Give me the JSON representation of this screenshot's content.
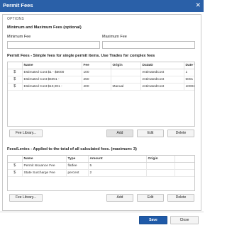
{
  "dialog": {
    "title": "Permit Fees",
    "close_icon": "close-icon"
  },
  "options": {
    "label": "OPTIONS"
  },
  "min_max": {
    "heading": "Minimum and Maximum Fees (optional)",
    "min_label": "Minimum Fee",
    "max_label": "Maximum Fee",
    "min_value": "",
    "max_value": ""
  },
  "permit_fees": {
    "heading": "Permit Fees - Simple fees for single permit items. Use Trades for complex fees",
    "columns": [
      "",
      "Name",
      "Fee",
      "Origin",
      "DataID",
      "Date Va"
    ],
    "rows": [
      {
        "icon": "$",
        "name": "Estimated Cost $1 - $5000",
        "fee": "100",
        "origin": "",
        "dataid": "estimatedCost",
        "dateval": "1"
      },
      {
        "icon": "$",
        "name": "Estimated Cost $5001 -",
        "fee": "250",
        "origin": "",
        "dataid": "estimatedCost",
        "dateval": "5001"
      },
      {
        "icon": "$",
        "name": "Estimated Cost $10,001 -",
        "fee": "400",
        "origin": "Manual",
        "dataid": "estimatedCost",
        "dateval": "10001"
      }
    ],
    "buttons": {
      "library": "Fee Library...",
      "add": "Add",
      "edit": "Edit",
      "delete": "Delete"
    }
  },
  "levies": {
    "heading": "Fees/Levies - Applied to the total of all calculated fees. (maximum: 3)",
    "columns": [
      "",
      "Name",
      "Type",
      "Amount",
      "Origin"
    ],
    "rows": [
      {
        "icon": "$",
        "name": "Permit Issuance Fee",
        "type": "flatfee",
        "amount": "5",
        "origin": ""
      },
      {
        "icon": "$",
        "name": "State Surcharge Fee",
        "type": "percent",
        "amount": "2",
        "origin": ""
      }
    ],
    "buttons": {
      "library": "Fee Library...",
      "add": "Add",
      "edit": "Edit",
      "delete": "Delete"
    }
  },
  "footer": {
    "save": "Save",
    "close": "Close"
  }
}
